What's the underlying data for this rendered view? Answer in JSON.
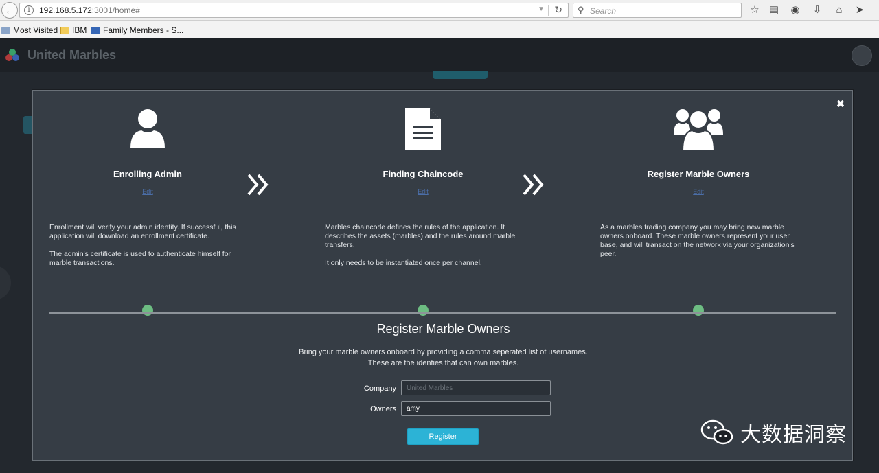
{
  "browser": {
    "url_host": "192.168.5.172",
    "url_path": ":3001/home#",
    "search_placeholder": "Search",
    "bookmarks": [
      "Most Visited",
      "IBM",
      "Family Members - S..."
    ]
  },
  "app": {
    "title": "United Marbles"
  },
  "modal": {
    "steps": [
      {
        "title": "Enrolling Admin",
        "edit": "Edit",
        "desc": [
          "Enrollment will verify your admin identity. If successful, this application will download an enrollment certificate.",
          "The admin's certificate is used to authenticate himself for marble transactions."
        ],
        "icon": "user-icon"
      },
      {
        "title": "Finding Chaincode",
        "edit": "Edit",
        "desc": [
          "Marbles chaincode defines the rules of the application. It describes the assets (marbles) and the rules around marble transfers.",
          "It only needs to be instantiated once per channel."
        ],
        "icon": "document-icon"
      },
      {
        "title": "Register Marble Owners",
        "edit": "Edit",
        "desc": [
          "As a marbles trading company you may bring new marble owners onboard. These marble owners represent your user base, and will transact on the network via your organization's peer."
        ],
        "icon": "users-icon"
      }
    ],
    "form": {
      "title": "Register Marble Owners",
      "desc_line1": "Bring your marble owners onboard by providing a comma seperated list of usernames.",
      "desc_line2": "These are the identies that can own marbles.",
      "company_label": "Company",
      "company_placeholder": "United Marbles",
      "owners_label": "Owners",
      "owners_value": "amy",
      "register_label": "Register"
    },
    "colors": {
      "status_dot": "#6dbd82",
      "register_button": "#2cb3d6"
    }
  },
  "watermark": {
    "text": "大数据洞察"
  }
}
